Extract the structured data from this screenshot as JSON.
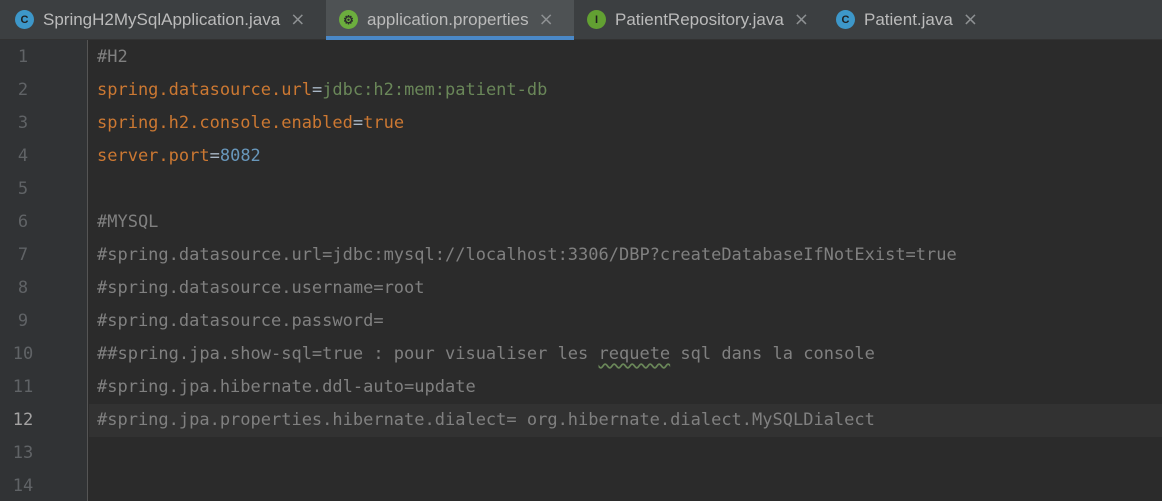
{
  "tabs": [
    {
      "label": "SpringH2MySqlApplication.java",
      "icon": "spring-class-icon",
      "icon_glyph": "C",
      "icon_color": "#3d97c9",
      "active": false,
      "close": "×"
    },
    {
      "label": "application.properties",
      "icon": "spring-leaf-icon",
      "icon_glyph": "⚙",
      "icon_color": "#6cae3e",
      "active": true,
      "close": "×"
    },
    {
      "label": "PatientRepository.java",
      "icon": "interface-icon",
      "icon_glyph": "I",
      "icon_color": "#62a032",
      "active": false,
      "close": "×"
    },
    {
      "label": "Patient.java",
      "icon": "class-icon",
      "icon_glyph": "C",
      "icon_color": "#3d97c9",
      "active": false,
      "close": "×"
    }
  ],
  "editor": {
    "current_line": 12,
    "line_numbers": [
      "1",
      "2",
      "3",
      "4",
      "5",
      "6",
      "7",
      "8",
      "9",
      "10",
      "11",
      "12",
      "13",
      "14"
    ],
    "lines": [
      {
        "segments": [
          {
            "text": "#H2",
            "cls": "comment"
          }
        ]
      },
      {
        "segments": [
          {
            "text": "spring.datasource.url",
            "cls": "key"
          },
          {
            "text": "=",
            "cls": "plain"
          },
          {
            "text": "jdbc:h2:mem:patient-db",
            "cls": "val"
          }
        ]
      },
      {
        "segments": [
          {
            "text": "spring.h2.console.enabled",
            "cls": "key"
          },
          {
            "text": "=",
            "cls": "plain"
          },
          {
            "text": "true",
            "cls": "key"
          }
        ]
      },
      {
        "segments": [
          {
            "text": "server.port",
            "cls": "key"
          },
          {
            "text": "=",
            "cls": "plain"
          },
          {
            "text": "8082",
            "cls": "num"
          }
        ]
      },
      {
        "segments": []
      },
      {
        "segments": [
          {
            "text": "#MYSQL",
            "cls": "comment"
          }
        ]
      },
      {
        "segments": [
          {
            "text": "#spring.datasource.url=jdbc:mysql://localhost:3306/DBP?createDatabaseIfNotExist=true",
            "cls": "comment"
          }
        ]
      },
      {
        "segments": [
          {
            "text": "#spring.datasource.username=root",
            "cls": "comment"
          }
        ]
      },
      {
        "segments": [
          {
            "text": "#spring.datasource.password=",
            "cls": "comment"
          }
        ]
      },
      {
        "segments": [
          {
            "text": "##spring.jpa.show-sql=true : pour visualiser les ",
            "cls": "comment"
          },
          {
            "text": "requete",
            "cls": "comment typo"
          },
          {
            "text": " sql dans la console",
            "cls": "comment"
          }
        ]
      },
      {
        "segments": [
          {
            "text": "#spring.jpa.hibernate.ddl-auto=update",
            "cls": "comment"
          }
        ]
      },
      {
        "segments": [
          {
            "text": "#spring.jpa.properties.hibernate.dialect= org.hibernate.dialect.MySQLDialect",
            "cls": "comment"
          }
        ]
      },
      {
        "segments": []
      },
      {
        "segments": []
      }
    ]
  }
}
